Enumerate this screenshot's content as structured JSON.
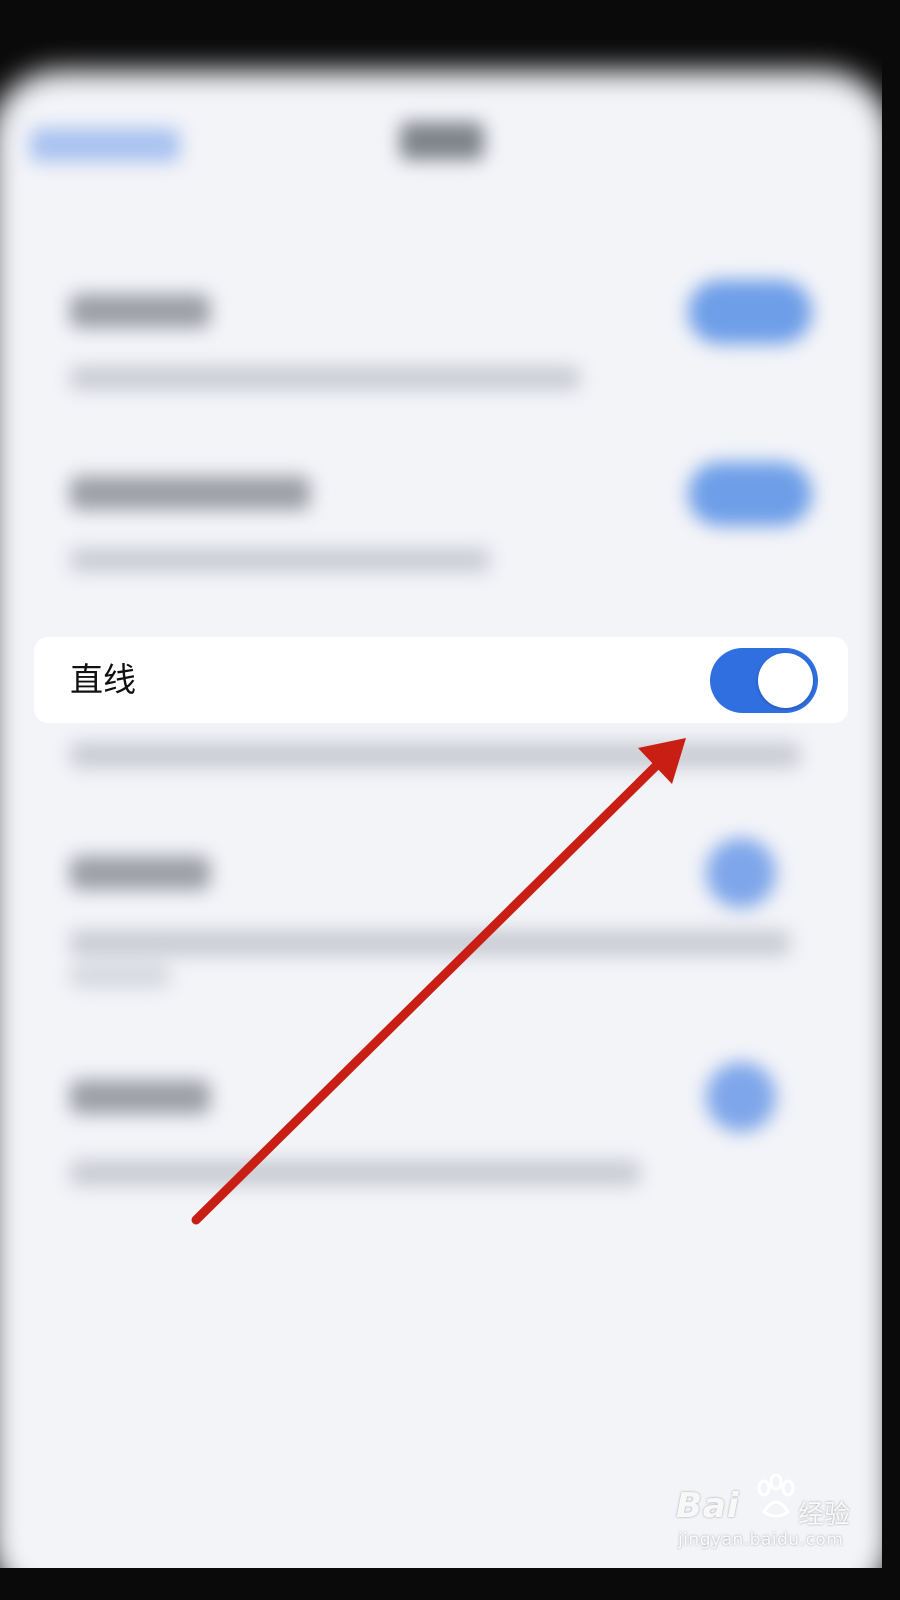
{
  "setting_row": {
    "label": "直线",
    "toggle_on": true
  },
  "colors": {
    "toggle_on": "#2f6fe0",
    "arrow": "#c81e14"
  },
  "watermark": {
    "brand": "Bai",
    "suffix": "经验",
    "url": "jingyan.baidu.com"
  },
  "icons": [
    "arrow-annotation-icon",
    "paw-logo-icon"
  ]
}
